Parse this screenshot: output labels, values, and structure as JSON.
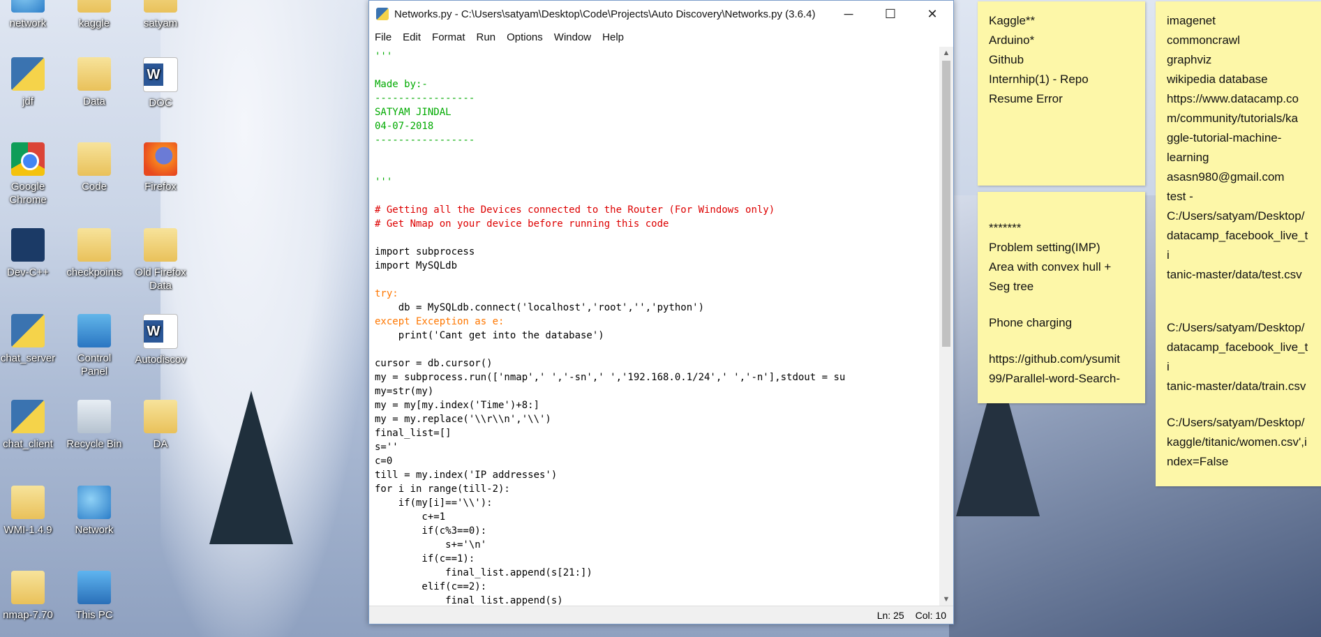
{
  "desktop": {
    "icons": [
      {
        "label": "network"
      },
      {
        "label": "kaggle"
      },
      {
        "label": "satyam"
      },
      {
        "label": "jdf"
      },
      {
        "label": "Data"
      },
      {
        "label": "DOC"
      },
      {
        "label": "Google Chrome"
      },
      {
        "label": "Code"
      },
      {
        "label": "Firefox"
      },
      {
        "label": "Dev-C++"
      },
      {
        "label": "checkpoints"
      },
      {
        "label": "Old Firefox Data"
      },
      {
        "label": "chat_server"
      },
      {
        "label": "Control Panel"
      },
      {
        "label": "Autodiscov"
      },
      {
        "label": "chat_client"
      },
      {
        "label": "Recycle Bin"
      },
      {
        "label": "DA"
      },
      {
        "label": "WMI-1.4.9"
      },
      {
        "label": "Network"
      },
      {
        "label": "nmap-7.70"
      },
      {
        "label": "This PC"
      }
    ]
  },
  "window": {
    "title": "Networks.py - C:\\Users\\satyam\\Desktop\\Code\\Projects\\Auto Discovery\\Networks.py (3.6.4)",
    "minimize": "─",
    "maximize": "☐",
    "close": "✕",
    "menu": [
      "File",
      "Edit",
      "Format",
      "Run",
      "Options",
      "Window",
      "Help"
    ],
    "code_lines": [
      {
        "t": "'''",
        "c": "#00aa00"
      },
      {
        "t": "",
        "c": "#000"
      },
      {
        "t": "Made by:-",
        "c": "#00aa00"
      },
      {
        "t": "-----------------",
        "c": "#00aa00"
      },
      {
        "t": "SATYAM JINDAL",
        "c": "#00aa00"
      },
      {
        "t": "04-07-2018",
        "c": "#00aa00"
      },
      {
        "t": "-----------------",
        "c": "#00aa00"
      },
      {
        "t": "",
        "c": "#000"
      },
      {
        "t": "",
        "c": "#000"
      },
      {
        "t": "'''",
        "c": "#00aa00"
      },
      {
        "t": "",
        "c": "#000"
      },
      {
        "t": "# Getting all the Devices connected to the Router (For Windows only)",
        "c": "#dd0000"
      },
      {
        "t": "# Get Nmap on your device before running this code",
        "c": "#dd0000"
      },
      {
        "t": "",
        "c": "#000"
      },
      {
        "t": "import subprocess",
        "c": "#000"
      },
      {
        "t": "import MySQLdb",
        "c": "#000"
      },
      {
        "t": "",
        "c": "#000"
      },
      {
        "t": "try:",
        "c": "#ff7700"
      },
      {
        "t": "    db = MySQLdb.connect('localhost','root','','python')",
        "c": "#000"
      },
      {
        "t": "except Exception as e:",
        "c": "#ff7700"
      },
      {
        "t": "    print('Cant get into the database')",
        "c": "#000"
      },
      {
        "t": "",
        "c": "#000"
      },
      {
        "t": "cursor = db.cursor()",
        "c": "#000"
      },
      {
        "t": "my = subprocess.run(['nmap',' ','-sn',' ','192.168.0.1/24',' ','-n'],stdout = su",
        "c": "#000"
      },
      {
        "t": "my=str(my)",
        "c": "#000"
      },
      {
        "t": "my = my[my.index('Time')+8:]",
        "c": "#000"
      },
      {
        "t": "my = my.replace('\\\\r\\\\n','\\\\')",
        "c": "#000"
      },
      {
        "t": "final_list=[]",
        "c": "#000"
      },
      {
        "t": "s=''",
        "c": "#000"
      },
      {
        "t": "c=0",
        "c": "#000"
      },
      {
        "t": "till = my.index('IP addresses')",
        "c": "#000"
      },
      {
        "t": "for i in range(till-2):",
        "c": "#000"
      },
      {
        "t": "    if(my[i]=='\\\\'):",
        "c": "#000"
      },
      {
        "t": "        c+=1",
        "c": "#000"
      },
      {
        "t": "        if(c%3==0):",
        "c": "#000"
      },
      {
        "t": "            s+='\\n'",
        "c": "#000"
      },
      {
        "t": "        if(c==1):",
        "c": "#000"
      },
      {
        "t": "            final_list.append(s[21:])",
        "c": "#000"
      },
      {
        "t": "        elif(c==2):",
        "c": "#000"
      },
      {
        "t": "            final_list.append(s)",
        "c": "#000"
      }
    ],
    "status_ln": "Ln: 25",
    "status_col": "Col: 10"
  },
  "notes": [
    {
      "lines": [
        "Kaggle**",
        "Arduino*",
        "Github",
        "Internhip(1) - Repo",
        "Resume Error"
      ]
    },
    {
      "lines": [
        "",
        "*******",
        "Problem setting(IMP)",
        "Area with convex hull +",
        "Seg tree",
        "",
        "Phone charging",
        "",
        "https://github.com/ysumit",
        "99/Parallel-word-Search-"
      ]
    },
    {
      "lines": [
        "imagenet",
        "commoncrawl",
        "graphviz",
        "wikipedia database",
        "https://www.datacamp.co",
        "m/community/tutorials/ka",
        "ggle-tutorial-machine-",
        "learning",
        "asasn980@gmail.com",
        "test -",
        "C:/Users/satyam/Desktop/",
        "datacamp_facebook_live_ti",
        "tanic-master/data/test.csv",
        "",
        "",
        "C:/Users/satyam/Desktop/",
        "datacamp_facebook_live_ti",
        "tanic-master/data/train.csv",
        "",
        "C:/Users/satyam/Desktop/",
        "kaggle/titanic/women.csv',i",
        "ndex=False"
      ]
    }
  ]
}
